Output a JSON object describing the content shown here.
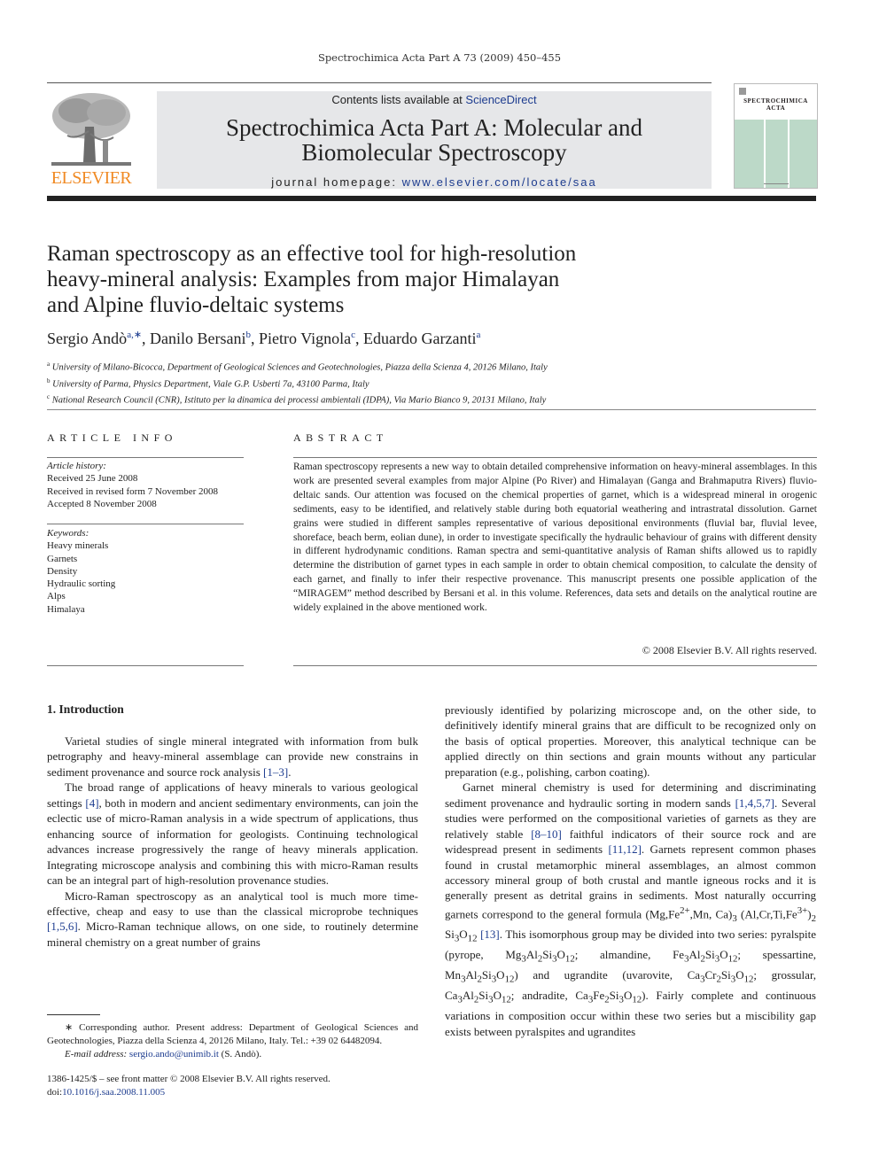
{
  "running_head": "Spectrochimica Acta Part A 73 (2009) 450–455",
  "publisher": {
    "logo_word": "ELSEVIER",
    "logo_color": "#f08a24"
  },
  "banner": {
    "contents_prefix": "Contents lists available at ",
    "contents_link": "ScienceDirect",
    "journal_title_line1": "Spectrochimica Acta Part A: Molecular and",
    "journal_title_line2": "Biomolecular Spectroscopy",
    "homepage_prefix": "journal homepage: ",
    "homepage_url": "www.elsevier.com/locate/saa"
  },
  "cover": {
    "title_line1": "SPECTROCHIMICA",
    "title_line2": "ACTA",
    "color": "#bcd9c8"
  },
  "article": {
    "title_lines": [
      "Raman spectroscopy as an effective tool for high-resolution",
      "heavy-mineral analysis: Examples from major Himalayan",
      "and Alpine fluvio-deltaic systems"
    ],
    "authors": [
      {
        "name": "Sergio Andò",
        "sup": "a,∗",
        "sep": ", "
      },
      {
        "name": "Danilo Bersani",
        "sup": "b",
        "sep": ", "
      },
      {
        "name": "Pietro Vignola",
        "sup": "c",
        "sep": ", "
      },
      {
        "name": "Eduardo Garzanti",
        "sup": "a",
        "sep": ""
      }
    ],
    "affiliations": [
      {
        "mark": "a",
        "text": "University of Milano-Bicocca, Department of Geological Sciences and Geotechnologies, Piazza della Scienza 4, 20126 Milano, Italy"
      },
      {
        "mark": "b",
        "text": "University of Parma, Physics Department, Viale G.P. Usberti 7a, 43100 Parma, Italy"
      },
      {
        "mark": "c",
        "text": "National Research Council (CNR), Istituto per la dinamica dei processi ambientali (IDPA), Via Mario Bianco 9, 20131 Milano, Italy"
      }
    ]
  },
  "article_info": {
    "heading": "ARTICLE INFO",
    "history_label": "Article history:",
    "history": [
      "Received 25 June 2008",
      "Received in revised form 7 November 2008",
      "Accepted 8 November 2008"
    ],
    "keywords_label": "Keywords:",
    "keywords": [
      "Heavy minerals",
      "Garnets",
      "Density",
      "Hydraulic sorting",
      "Alps",
      "Himalaya"
    ]
  },
  "abstract": {
    "heading": "ABSTRACT",
    "text": "Raman spectroscopy represents a new way to obtain detailed comprehensive information on heavy-mineral assemblages. In this work are presented several examples from major Alpine (Po River) and Himalayan (Ganga and Brahmaputra Rivers) fluvio-deltaic sands. Our attention was focused on the chemical properties of garnet, which is a widespread mineral in orogenic sediments, easy to be identified, and relatively stable during both equatorial weathering and intrastratal dissolution. Garnet grains were studied in different samples representative of various depositional environments (fluvial bar, fluvial levee, shoreface, beach berm, eolian dune), in order to investigate specifically the hydraulic behaviour of grains with different density in different hydrodynamic conditions. Raman spectra and semi-quantitative analysis of Raman shifts allowed us to rapidly determine the distribution of garnet types in each sample in order to obtain chemical composition, to calculate the density of each garnet, and finally to infer their respective provenance. This manuscript presents one possible application of the “MIRAGEM” method described by Bersani et al. in this volume. References, data sets and details on the analytical routine are widely explained in the above mentioned work.",
    "copyright": "© 2008 Elsevier B.V. All rights reserved."
  },
  "body": {
    "section_heading": "1.  Introduction",
    "left_paragraphs": [
      {
        "parts": [
          {
            "t": "Varietal studies of single mineral integrated with information from bulk petrography and heavy-mineral assemblage can provide new constrains in sediment provenance and source rock analysis "
          },
          {
            "r": "[1–3]"
          },
          {
            "t": "."
          }
        ]
      },
      {
        "parts": [
          {
            "t": "The broad range of applications of heavy minerals to various geological settings "
          },
          {
            "r": "[4]"
          },
          {
            "t": ", both in modern and ancient sedimentary environments, can join the eclectic use of micro-Raman analysis in a wide spectrum of applications, thus enhancing source of information for geologists. Continuing technological advances increase progressively the range of heavy minerals application. Integrating microscope analysis and combining this with micro-Raman results can be an integral part of high-resolution provenance studies."
          }
        ]
      },
      {
        "parts": [
          {
            "t": "Micro-Raman spectroscopy as an analytical tool is much more time-effective, cheap and easy to use than the classical microprobe techniques "
          },
          {
            "r": "[1,5,6]"
          },
          {
            "t": ". Micro-Raman technique allows, on one side, to routinely determine mineral chemistry on a great number of grains"
          }
        ]
      }
    ],
    "right_paragraphs": [
      {
        "noindent": true,
        "parts": [
          {
            "t": "previously identified by polarizing microscope and, on the other side, to definitively identify mineral grains that are difficult to be recognized only on the basis of optical properties. Moreover, this analytical technique can be applied directly on thin sections and grain mounts without any particular preparation (e.g., polishing, carbon coating)."
          }
        ]
      },
      {
        "parts": [
          {
            "t": "Garnet mineral chemistry is used for determining and discriminating sediment provenance and hydraulic sorting in modern sands "
          },
          {
            "r": "[1,4,5,7]"
          },
          {
            "t": ". Several studies were performed on the compositional varieties of garnets as they are relatively stable "
          },
          {
            "r": "[8–10]"
          },
          {
            "t": " faithful indicators of their source rock and are widespread present in sediments "
          },
          {
            "r": "[11,12]"
          },
          {
            "t": ". Garnets represent common phases found in crustal metamorphic mineral assemblages, an almost common accessory mineral group of both crustal and mantle igneous rocks and it is generally present as detrital grains in sediments. Most naturally occurring garnets correspond to the general formula (Mg,Fe"
          },
          {
            "sup": "2+"
          },
          {
            "t": ",Mn, Ca)"
          },
          {
            "sub": "3"
          },
          {
            "t": " (Al,Cr,Ti,Fe"
          },
          {
            "sup": "3+"
          },
          {
            "t": ")"
          },
          {
            "sub": "2"
          },
          {
            "t": " Si"
          },
          {
            "sub": "3"
          },
          {
            "t": "O"
          },
          {
            "sub": "12"
          },
          {
            "t": " "
          },
          {
            "r": "[13]"
          },
          {
            "t": ". This isomorphous group may be divided into two series: pyralspite (pyrope, Mg"
          },
          {
            "sub": "3"
          },
          {
            "t": "Al"
          },
          {
            "sub": "2"
          },
          {
            "t": "Si"
          },
          {
            "sub": "3"
          },
          {
            "t": "O"
          },
          {
            "sub": "12"
          },
          {
            "t": "; almandine, Fe"
          },
          {
            "sub": "3"
          },
          {
            "t": "Al"
          },
          {
            "sub": "2"
          },
          {
            "t": "Si"
          },
          {
            "sub": "3"
          },
          {
            "t": "O"
          },
          {
            "sub": "12"
          },
          {
            "t": "; spessartine, Mn"
          },
          {
            "sub": "3"
          },
          {
            "t": "Al"
          },
          {
            "sub": "2"
          },
          {
            "t": "Si"
          },
          {
            "sub": "3"
          },
          {
            "t": "O"
          },
          {
            "sub": "12"
          },
          {
            "t": ") and ugrandite (uvarovite, Ca"
          },
          {
            "sub": "3"
          },
          {
            "t": "Cr"
          },
          {
            "sub": "2"
          },
          {
            "t": "Si"
          },
          {
            "sub": "3"
          },
          {
            "t": "O"
          },
          {
            "sub": "12"
          },
          {
            "t": "; grossular, Ca"
          },
          {
            "sub": "3"
          },
          {
            "t": "Al"
          },
          {
            "sub": "2"
          },
          {
            "t": "Si"
          },
          {
            "sub": "3"
          },
          {
            "t": "O"
          },
          {
            "sub": "12"
          },
          {
            "t": "; andradite, Ca"
          },
          {
            "sub": "3"
          },
          {
            "t": "Fe"
          },
          {
            "sub": "2"
          },
          {
            "t": "Si"
          },
          {
            "sub": "3"
          },
          {
            "t": "O"
          },
          {
            "sub": "12"
          },
          {
            "t": "). Fairly complete and continuous variations in composition occur within these two series but a miscibility gap exists between pyralspites and ugrandites"
          }
        ]
      }
    ]
  },
  "footnotes": {
    "corresponding_mark": "∗",
    "corresponding_text": "Corresponding author. Present address: Department of Geological Sciences and Geotechnologies, Piazza della Scienza 4, 20126 Milano, Italy. Tel.: +39 02 64482094.",
    "email_label": "E-mail address: ",
    "email": "sergio.ando@unimib.it",
    "email_suffix": " (S. Andò).",
    "issn_line": "1386-1425/$ – see front matter © 2008 Elsevier B.V. All rights reserved.",
    "doi_prefix": "doi:",
    "doi": "10.1016/j.saa.2008.11.005"
  }
}
